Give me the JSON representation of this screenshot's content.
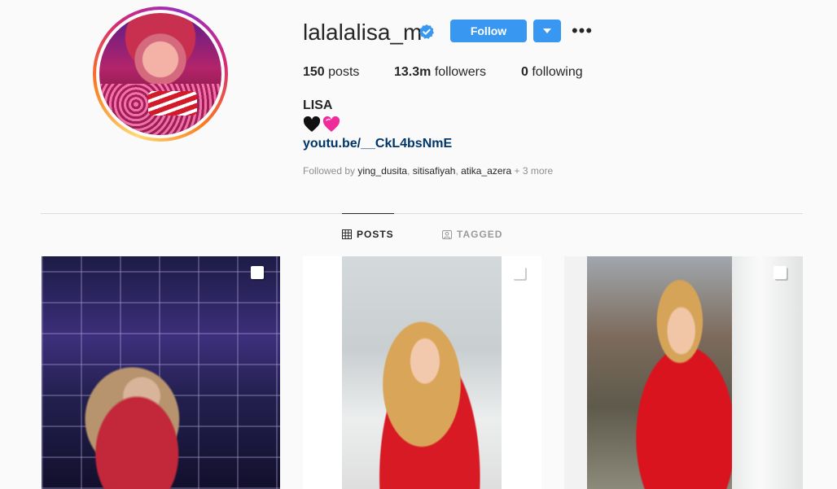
{
  "profile": {
    "username": "lalalalisa_m",
    "verified": true,
    "follow_label": "Follow",
    "full_name": "LISA",
    "link": "youtu.be/__CkL4bsNmE",
    "stats": {
      "posts_count": "150",
      "posts_label": "posts",
      "followers_count": "13.3m",
      "followers_label": "followers",
      "following_count": "0",
      "following_label": "following"
    },
    "followed_by": {
      "prefix": "Followed by",
      "names": [
        "ying_dusita",
        "sitisafiyah",
        "atika_azera"
      ],
      "more": "+ 3 more"
    }
  },
  "tabs": {
    "posts": "POSTS",
    "tagged": "TAGGED"
  },
  "colors": {
    "follow_blue": "#3897f0",
    "link_blue": "#003569",
    "muted_gray": "#8e8e8e",
    "background": "#fafafa"
  },
  "icons": {
    "verified": "verified-badge-icon",
    "dropdown": "chevron-down-icon",
    "more": "more-options-icon",
    "posts_tab": "grid-icon",
    "tagged_tab": "tagged-icon",
    "emojis": [
      "black-heart-icon",
      "pink-heart-icon"
    ],
    "multi_post": "multi-photo-icon"
  }
}
